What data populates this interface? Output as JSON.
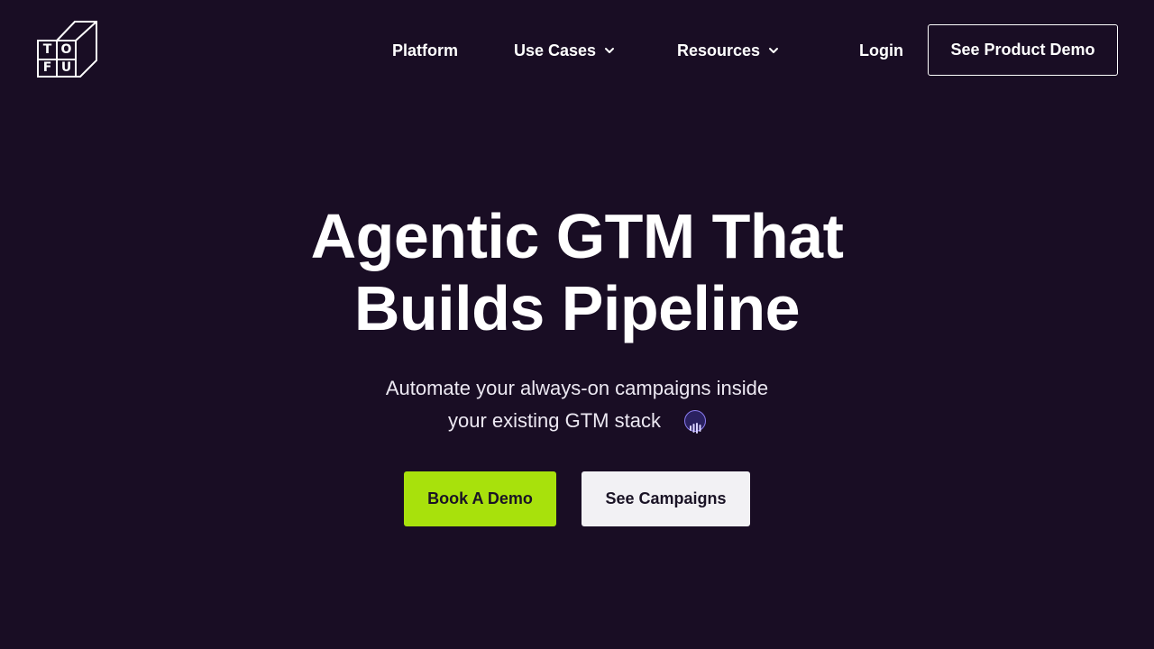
{
  "brand": {
    "logo_letters": [
      "T",
      "O",
      "F",
      "U"
    ],
    "logo_icon": "tofu-logo-icon"
  },
  "nav": {
    "items": [
      {
        "label": "Platform",
        "has_dropdown": false
      },
      {
        "label": "Use Cases",
        "has_dropdown": true
      },
      {
        "label": "Resources",
        "has_dropdown": true
      }
    ],
    "login_label": "Login",
    "demo_button_label": "See Product Demo"
  },
  "hero": {
    "title_line1": "Agentic GTM That",
    "title_line2": "Builds Pipeline",
    "subtitle_line1": "Automate your always-on campaigns inside",
    "subtitle_line2": "your existing GTM stack",
    "audio_icon": "audio-wave-icon",
    "primary_cta": "Book A Demo",
    "secondary_cta": "See Campaigns"
  },
  "colors": {
    "background": "#190d24",
    "primary_cta": "#a8e10c",
    "secondary_cta": "#f2f1f4",
    "audio_icon_accent": "#8b7cf0"
  }
}
